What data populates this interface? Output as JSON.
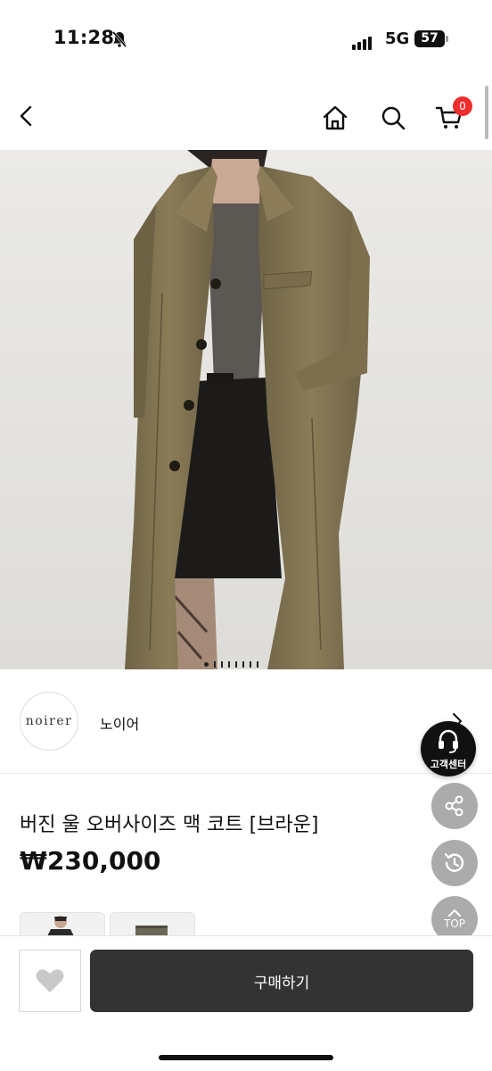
{
  "status_bar": {
    "time": "11:28",
    "network": "5G",
    "battery": "57"
  },
  "header": {
    "cart_count": "0"
  },
  "hero": {
    "slide_count": 8,
    "active_slide": 1
  },
  "brand": {
    "logo_text": "noirer",
    "name": "노이어"
  },
  "product": {
    "title": "버진 울 오버사이즈 맥 코트 [브라운]",
    "price": "₩230,000"
  },
  "floating": {
    "customer_center_label": "고객센터",
    "top_label": "TOP"
  },
  "bottom_bar": {
    "buy_label": "구매하기"
  },
  "colors": {
    "accent_badge": "#ef2e2e",
    "buy_button": "#333333",
    "fab": "#a7a7a7"
  }
}
